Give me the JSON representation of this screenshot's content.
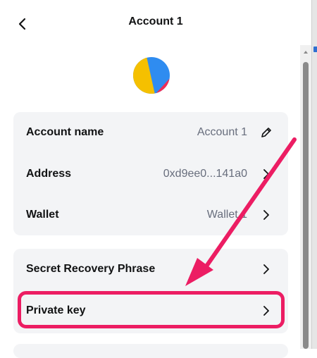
{
  "header": {
    "title": "Account 1",
    "back_icon": "chevron-left-icon"
  },
  "avatar": {
    "colors": [
      "#2f8cf0",
      "#f5c000",
      "#ef2d56"
    ]
  },
  "details": {
    "account_name": {
      "label": "Account name",
      "value": "Account 1",
      "icon": "pencil-icon"
    },
    "address": {
      "label": "Address",
      "value": "0xd9ee0...141a0",
      "icon": "chevron-right-icon"
    },
    "wallet": {
      "label": "Wallet",
      "value": "Wallet 1",
      "icon": "chevron-right-icon"
    }
  },
  "security": {
    "secret_recovery_phrase": {
      "label": "Secret Recovery Phrase",
      "icon": "chevron-right-icon"
    },
    "private_key": {
      "label": "Private key",
      "icon": "chevron-right-icon"
    }
  },
  "annotation": {
    "color": "#ec1d63"
  }
}
